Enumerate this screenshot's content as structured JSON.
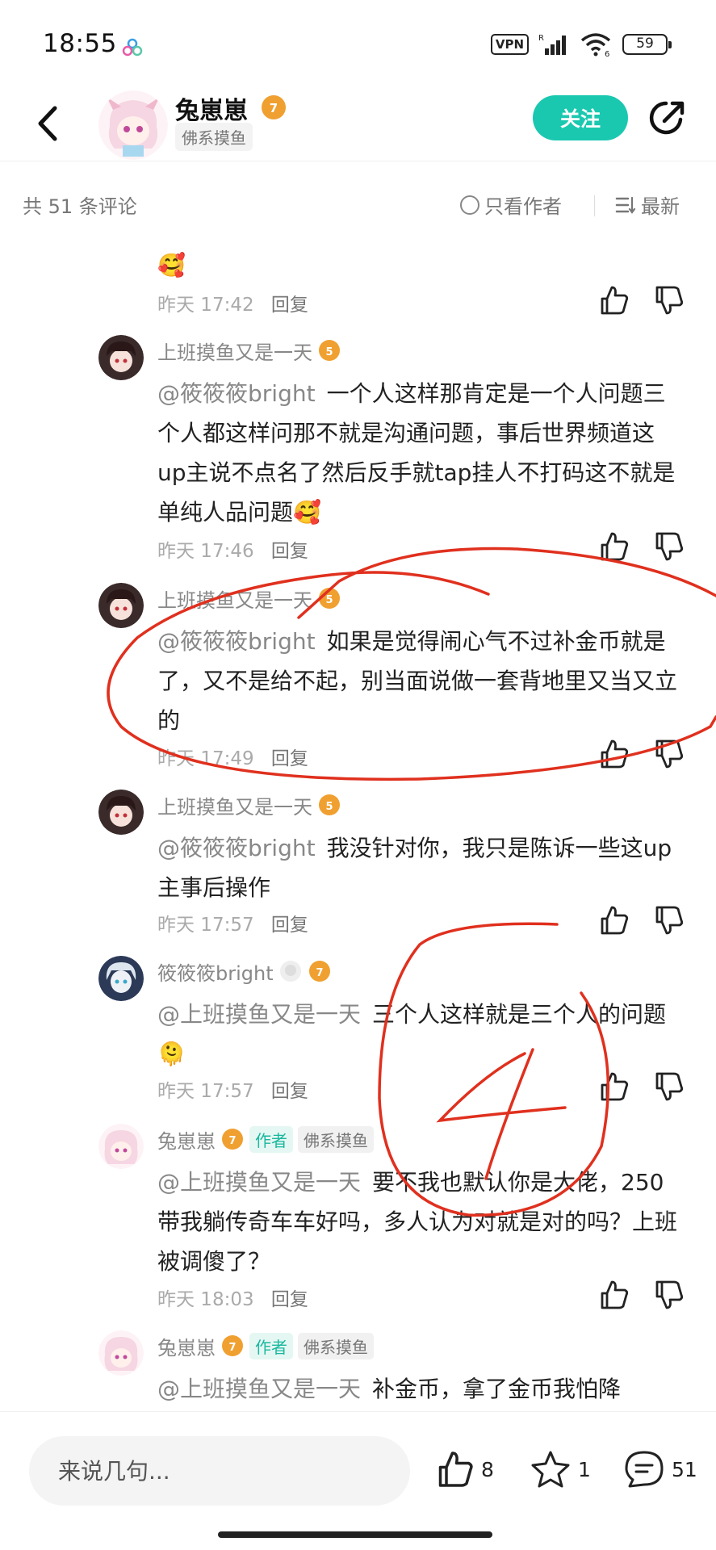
{
  "status_bar": {
    "time": "18:55",
    "vpn": "VPN",
    "signal_label": "R",
    "network": "6",
    "battery": "59"
  },
  "header": {
    "name": "兔崽崽",
    "level": "7",
    "tag": "佛系摸鱼",
    "follow_label": "关注"
  },
  "sort": {
    "count": "共 51 条评论",
    "only_author": "只看作者",
    "sort_label": "最新"
  },
  "comments": [
    {
      "time": "昨天 17:42",
      "reply": "回复"
    },
    {
      "user": "上班摸鱼又是一天",
      "level": "5",
      "mention": "@筱筱筱bright",
      "text": "一个人这样那肯定是一个人问题三个人都这样问那不就是沟通问题，事后世界频道这up主说不点名了然后反手就tap挂人不打码这不就是单纯人品问题",
      "time": "昨天 17:46",
      "reply": "回复"
    },
    {
      "user": "上班摸鱼又是一天",
      "level": "5",
      "mention": "@筱筱筱bright",
      "text": "如果是觉得闹心气不过补金币就是了，又不是给不起，别当面说做一套背地里又当又立的",
      "time": "昨天 17:49",
      "reply": "回复"
    },
    {
      "user": "上班摸鱼又是一天",
      "level": "5",
      "mention": "@筱筱筱bright",
      "text": "我没针对你，我只是陈诉一些这up主事后操作",
      "time": "昨天 17:57",
      "reply": "回复"
    },
    {
      "user": "筱筱筱bright",
      "level": "7",
      "mention": "@上班摸鱼又是一天",
      "text": "三个人这样就是三个人的问题",
      "time": "昨天 17:57",
      "reply": "回复"
    },
    {
      "user": "兔崽崽",
      "level": "7",
      "author_badge": "作者",
      "tag": "佛系摸鱼",
      "mention": "@上班摸鱼又是一天",
      "text": "要不我也默认你是大佬，250带我躺传奇车车好吗，多人认为对就是对的吗？上班被调傻了？",
      "time": "昨天 18:03",
      "reply": "回复"
    },
    {
      "user": "兔崽崽",
      "level": "7",
      "author_badge": "作者",
      "tag": "佛系摸鱼",
      "mention": "@上班摸鱼又是一天",
      "text": "补金币，拿了金币我怕降"
    }
  ],
  "bottom_bar": {
    "placeholder": "来说几句...",
    "likes": "8",
    "favorites": "1",
    "comments": "51"
  },
  "annotation": {
    "number": "4",
    "color": "#e0301e"
  },
  "colors": {
    "accent": "#1ac8b0",
    "level_badge": "#f0a030"
  }
}
